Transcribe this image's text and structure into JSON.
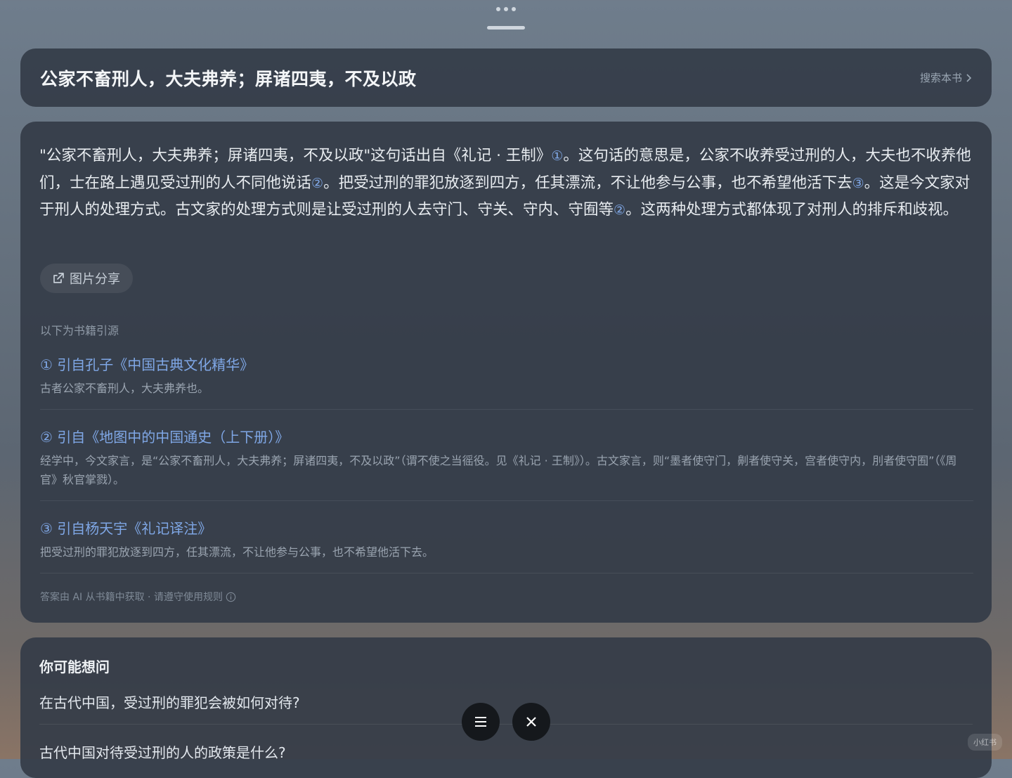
{
  "header": {
    "title": "公家不畜刑人，大夫弗养；屏诸四夷，不及以政",
    "search_link": "搜索本书"
  },
  "answer": {
    "part1": "\"公家不畜刑人，大夫弗养；屏诸四夷，不及以政\"这句话出自《礼记 · 王制》",
    "cite1": "①",
    "part2": "。这句话的意思是，公家不收养受过刑的人，大夫也不收养他们，士在路上遇见受过刑的人不同他说话",
    "cite2": "②",
    "part3": "。把受过刑的罪犯放逐到四方，任其漂流，不让他参与公事，也不希望他活下去",
    "cite3": "③",
    "part4": "。这是今文家对于刑人的处理方式。古文家的处理方式则是让受过刑的人去守门、守关、守内、守囿等",
    "cite4": "②",
    "part5": "。这两种处理方式都体现了对刑人的排斥和歧视。",
    "share_label": "图片分享",
    "refs_title": "以下为书籍引源",
    "references": [
      {
        "title": "① 引自孔子《中国古典文化精华》",
        "body": "古者公家不畜刑人，大夫弗养也。"
      },
      {
        "title": "② 引自《地图中的中国通史（上下册）》",
        "body": "经学中，今文家言，是“公家不畜刑人，大夫弗养；屏诸四夷，不及以政”（谓不使之当徭役。见《礼记 · 王制》）。古文家言，则“墨者使守门，劓者使守关，宫者使守内，刖者使守囿”（《周官》秋官掌戮）。"
      },
      {
        "title": "③ 引自杨天宇《礼记译注》",
        "body": "把受过刑的罪犯放逐到四方，任其漂流，不让他参与公事，也不希望他活下去。"
      }
    ],
    "disclaimer": "答案由 AI 从书籍中获取 · 请遵守使用规则"
  },
  "suggestions": {
    "title": "你可能想问",
    "items": [
      "在古代中国，受过刑的罪犯会被如何对待?",
      "古代中国对待受过刑的人的政策是什么?"
    ]
  },
  "watermark": "小红书",
  "icons": {
    "top": "more-dots-icon",
    "share": "external-share-icon",
    "info": "info-icon",
    "menu": "menu-icon",
    "close": "close-icon"
  }
}
